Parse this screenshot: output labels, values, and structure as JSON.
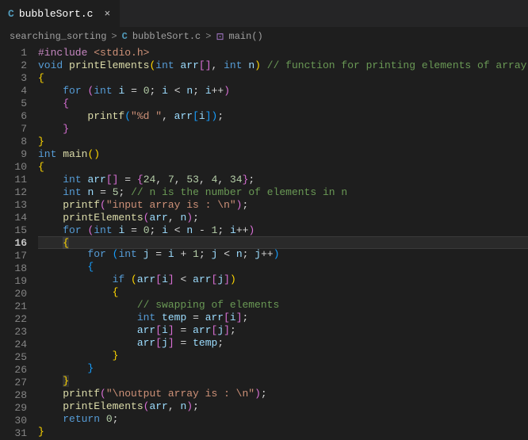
{
  "tab": {
    "icon": "C",
    "label": "bubbleSort.c",
    "close": "×"
  },
  "breadcrumbs": {
    "folder": "searching_sorting",
    "sep": ">",
    "file_icon": "C",
    "file": "bubbleSort.c",
    "fn_icon": "⊡",
    "fn": "main()"
  },
  "active_line": 16,
  "lines": [
    {
      "n": 1,
      "tokens": [
        [
          "tok-pp",
          "#include"
        ],
        [
          "tok-pn",
          " "
        ],
        [
          "tok-str",
          "<stdio.h>"
        ]
      ]
    },
    {
      "n": 2,
      "tokens": [
        [
          "tok-type",
          "void"
        ],
        [
          "tok-pn",
          " "
        ],
        [
          "tok-fn",
          "printElements"
        ],
        [
          "tok-br0",
          "("
        ],
        [
          "tok-type",
          "int"
        ],
        [
          "tok-pn",
          " "
        ],
        [
          "tok-var",
          "arr"
        ],
        [
          "tok-br1",
          "["
        ],
        [
          "tok-br1",
          "]"
        ],
        [
          "tok-pn",
          ", "
        ],
        [
          "tok-type",
          "int"
        ],
        [
          "tok-pn",
          " "
        ],
        [
          "tok-var",
          "n"
        ],
        [
          "tok-br0",
          ")"
        ],
        [
          "tok-pn",
          " "
        ],
        [
          "tok-cmt",
          "// function for printing elements of array"
        ]
      ]
    },
    {
      "n": 3,
      "tokens": [
        [
          "tok-br0",
          "{"
        ]
      ]
    },
    {
      "n": 4,
      "tokens": [
        [
          "tok-pn",
          "    "
        ],
        [
          "tok-kw",
          "for"
        ],
        [
          "tok-pn",
          " "
        ],
        [
          "tok-br1",
          "("
        ],
        [
          "tok-type",
          "int"
        ],
        [
          "tok-pn",
          " "
        ],
        [
          "tok-var",
          "i"
        ],
        [
          "tok-pn",
          " "
        ],
        [
          "tok-op",
          "="
        ],
        [
          "tok-pn",
          " "
        ],
        [
          "tok-num",
          "0"
        ],
        [
          "tok-pn",
          "; "
        ],
        [
          "tok-var",
          "i"
        ],
        [
          "tok-pn",
          " "
        ],
        [
          "tok-op",
          "<"
        ],
        [
          "tok-pn",
          " "
        ],
        [
          "tok-var",
          "n"
        ],
        [
          "tok-pn",
          "; "
        ],
        [
          "tok-var",
          "i"
        ],
        [
          "tok-op",
          "++"
        ],
        [
          "tok-br1",
          ")"
        ]
      ]
    },
    {
      "n": 5,
      "tokens": [
        [
          "tok-pn",
          "    "
        ],
        [
          "tok-br1",
          "{"
        ]
      ]
    },
    {
      "n": 6,
      "tokens": [
        [
          "tok-pn",
          "        "
        ],
        [
          "tok-fn",
          "printf"
        ],
        [
          "tok-br2",
          "("
        ],
        [
          "tok-str",
          "\"%d \""
        ],
        [
          "tok-pn",
          ", "
        ],
        [
          "tok-var",
          "arr"
        ],
        [
          "tok-br2",
          "["
        ],
        [
          "tok-var",
          "i"
        ],
        [
          "tok-br2",
          "]"
        ],
        [
          "tok-br2",
          ")"
        ],
        [
          "tok-pn",
          ";"
        ]
      ]
    },
    {
      "n": 7,
      "tokens": [
        [
          "tok-pn",
          "    "
        ],
        [
          "tok-br1",
          "}"
        ]
      ]
    },
    {
      "n": 8,
      "tokens": [
        [
          "tok-br0",
          "}"
        ]
      ]
    },
    {
      "n": 9,
      "tokens": [
        [
          "tok-type",
          "int"
        ],
        [
          "tok-pn",
          " "
        ],
        [
          "tok-fn",
          "main"
        ],
        [
          "tok-br0",
          "("
        ],
        [
          "tok-br0",
          ")"
        ]
      ]
    },
    {
      "n": 10,
      "tokens": [
        [
          "tok-br0",
          "{"
        ]
      ]
    },
    {
      "n": 11,
      "tokens": [
        [
          "tok-pn",
          "    "
        ],
        [
          "tok-type",
          "int"
        ],
        [
          "tok-pn",
          " "
        ],
        [
          "tok-var",
          "arr"
        ],
        [
          "tok-br1",
          "["
        ],
        [
          "tok-br1",
          "]"
        ],
        [
          "tok-pn",
          " "
        ],
        [
          "tok-op",
          "="
        ],
        [
          "tok-pn",
          " "
        ],
        [
          "tok-br1",
          "{"
        ],
        [
          "tok-num",
          "24"
        ],
        [
          "tok-pn",
          ", "
        ],
        [
          "tok-num",
          "7"
        ],
        [
          "tok-pn",
          ", "
        ],
        [
          "tok-num",
          "53"
        ],
        [
          "tok-pn",
          ", "
        ],
        [
          "tok-num",
          "4"
        ],
        [
          "tok-pn",
          ", "
        ],
        [
          "tok-num",
          "34"
        ],
        [
          "tok-br1",
          "}"
        ],
        [
          "tok-pn",
          ";"
        ]
      ]
    },
    {
      "n": 12,
      "tokens": [
        [
          "tok-pn",
          "    "
        ],
        [
          "tok-type",
          "int"
        ],
        [
          "tok-pn",
          " "
        ],
        [
          "tok-var",
          "n"
        ],
        [
          "tok-pn",
          " "
        ],
        [
          "tok-op",
          "="
        ],
        [
          "tok-pn",
          " "
        ],
        [
          "tok-num",
          "5"
        ],
        [
          "tok-pn",
          "; "
        ],
        [
          "tok-cmt",
          "// n is the number of elements in n"
        ]
      ]
    },
    {
      "n": 13,
      "tokens": [
        [
          "tok-pn",
          "    "
        ],
        [
          "tok-fn",
          "printf"
        ],
        [
          "tok-br1",
          "("
        ],
        [
          "tok-str",
          "\"input array is : \\n\""
        ],
        [
          "tok-br1",
          ")"
        ],
        [
          "tok-pn",
          ";"
        ]
      ]
    },
    {
      "n": 14,
      "tokens": [
        [
          "tok-pn",
          "    "
        ],
        [
          "tok-fn",
          "printElements"
        ],
        [
          "tok-br1",
          "("
        ],
        [
          "tok-var",
          "arr"
        ],
        [
          "tok-pn",
          ", "
        ],
        [
          "tok-var",
          "n"
        ],
        [
          "tok-br1",
          ")"
        ],
        [
          "tok-pn",
          ";"
        ]
      ]
    },
    {
      "n": 15,
      "tokens": [
        [
          "tok-pn",
          "    "
        ],
        [
          "tok-kw",
          "for"
        ],
        [
          "tok-pn",
          " "
        ],
        [
          "tok-br1",
          "("
        ],
        [
          "tok-type",
          "int"
        ],
        [
          "tok-pn",
          " "
        ],
        [
          "tok-var",
          "i"
        ],
        [
          "tok-pn",
          " "
        ],
        [
          "tok-op",
          "="
        ],
        [
          "tok-pn",
          " "
        ],
        [
          "tok-num",
          "0"
        ],
        [
          "tok-pn",
          "; "
        ],
        [
          "tok-var",
          "i"
        ],
        [
          "tok-pn",
          " "
        ],
        [
          "tok-op",
          "<"
        ],
        [
          "tok-pn",
          " "
        ],
        [
          "tok-var",
          "n"
        ],
        [
          "tok-pn",
          " "
        ],
        [
          "tok-op",
          "-"
        ],
        [
          "tok-pn",
          " "
        ],
        [
          "tok-num",
          "1"
        ],
        [
          "tok-pn",
          "; "
        ],
        [
          "tok-var",
          "i"
        ],
        [
          "tok-op",
          "++"
        ],
        [
          "tok-br1",
          ")"
        ]
      ]
    },
    {
      "n": 16,
      "tokens": [
        [
          "tok-pn",
          "    "
        ],
        [
          "tok-bb",
          "{"
        ]
      ]
    },
    {
      "n": 17,
      "tokens": [
        [
          "tok-pn",
          "        "
        ],
        [
          "tok-kw",
          "for"
        ],
        [
          "tok-pn",
          " "
        ],
        [
          "tok-br2",
          "("
        ],
        [
          "tok-type",
          "int"
        ],
        [
          "tok-pn",
          " "
        ],
        [
          "tok-var",
          "j"
        ],
        [
          "tok-pn",
          " "
        ],
        [
          "tok-op",
          "="
        ],
        [
          "tok-pn",
          " "
        ],
        [
          "tok-var",
          "i"
        ],
        [
          "tok-pn",
          " "
        ],
        [
          "tok-op",
          "+"
        ],
        [
          "tok-pn",
          " "
        ],
        [
          "tok-num",
          "1"
        ],
        [
          "tok-pn",
          "; "
        ],
        [
          "tok-var",
          "j"
        ],
        [
          "tok-pn",
          " "
        ],
        [
          "tok-op",
          "<"
        ],
        [
          "tok-pn",
          " "
        ],
        [
          "tok-var",
          "n"
        ],
        [
          "tok-pn",
          "; "
        ],
        [
          "tok-var",
          "j"
        ],
        [
          "tok-op",
          "++"
        ],
        [
          "tok-br2",
          ")"
        ]
      ]
    },
    {
      "n": 18,
      "tokens": [
        [
          "tok-pn",
          "        "
        ],
        [
          "tok-br2",
          "{"
        ]
      ]
    },
    {
      "n": 19,
      "tokens": [
        [
          "tok-pn",
          "            "
        ],
        [
          "tok-kw",
          "if"
        ],
        [
          "tok-pn",
          " "
        ],
        [
          "tok-br0",
          "("
        ],
        [
          "tok-var",
          "arr"
        ],
        [
          "tok-br1",
          "["
        ],
        [
          "tok-var",
          "i"
        ],
        [
          "tok-br1",
          "]"
        ],
        [
          "tok-pn",
          " "
        ],
        [
          "tok-op",
          "<"
        ],
        [
          "tok-pn",
          " "
        ],
        [
          "tok-var",
          "arr"
        ],
        [
          "tok-br1",
          "["
        ],
        [
          "tok-var",
          "j"
        ],
        [
          "tok-br1",
          "]"
        ],
        [
          "tok-br0",
          ")"
        ]
      ]
    },
    {
      "n": 20,
      "tokens": [
        [
          "tok-pn",
          "            "
        ],
        [
          "tok-br0",
          "{"
        ]
      ]
    },
    {
      "n": 21,
      "tokens": [
        [
          "tok-pn",
          "                "
        ],
        [
          "tok-cmt",
          "// swapping of elements"
        ]
      ]
    },
    {
      "n": 22,
      "tokens": [
        [
          "tok-pn",
          "                "
        ],
        [
          "tok-type",
          "int"
        ],
        [
          "tok-pn",
          " "
        ],
        [
          "tok-var",
          "temp"
        ],
        [
          "tok-pn",
          " "
        ],
        [
          "tok-op",
          "="
        ],
        [
          "tok-pn",
          " "
        ],
        [
          "tok-var",
          "arr"
        ],
        [
          "tok-br1",
          "["
        ],
        [
          "tok-var",
          "i"
        ],
        [
          "tok-br1",
          "]"
        ],
        [
          "tok-pn",
          ";"
        ]
      ]
    },
    {
      "n": 23,
      "tokens": [
        [
          "tok-pn",
          "                "
        ],
        [
          "tok-var",
          "arr"
        ],
        [
          "tok-br1",
          "["
        ],
        [
          "tok-var",
          "i"
        ],
        [
          "tok-br1",
          "]"
        ],
        [
          "tok-pn",
          " "
        ],
        [
          "tok-op",
          "="
        ],
        [
          "tok-pn",
          " "
        ],
        [
          "tok-var",
          "arr"
        ],
        [
          "tok-br1",
          "["
        ],
        [
          "tok-var",
          "j"
        ],
        [
          "tok-br1",
          "]"
        ],
        [
          "tok-pn",
          ";"
        ]
      ]
    },
    {
      "n": 24,
      "tokens": [
        [
          "tok-pn",
          "                "
        ],
        [
          "tok-var",
          "arr"
        ],
        [
          "tok-br1",
          "["
        ],
        [
          "tok-var",
          "j"
        ],
        [
          "tok-br1",
          "]"
        ],
        [
          "tok-pn",
          " "
        ],
        [
          "tok-op",
          "="
        ],
        [
          "tok-pn",
          " "
        ],
        [
          "tok-var",
          "temp"
        ],
        [
          "tok-pn",
          ";"
        ]
      ]
    },
    {
      "n": 25,
      "tokens": [
        [
          "tok-pn",
          "            "
        ],
        [
          "tok-br0",
          "}"
        ]
      ]
    },
    {
      "n": 26,
      "tokens": [
        [
          "tok-pn",
          "        "
        ],
        [
          "tok-br2",
          "}"
        ]
      ]
    },
    {
      "n": 27,
      "tokens": [
        [
          "tok-pn",
          "    "
        ],
        [
          "tok-bb",
          "}"
        ]
      ]
    },
    {
      "n": 28,
      "tokens": [
        [
          "tok-pn",
          "    "
        ],
        [
          "tok-fn",
          "printf"
        ],
        [
          "tok-br1",
          "("
        ],
        [
          "tok-str",
          "\"\\noutput array is : \\n\""
        ],
        [
          "tok-br1",
          ")"
        ],
        [
          "tok-pn",
          ";"
        ]
      ]
    },
    {
      "n": 29,
      "tokens": [
        [
          "tok-pn",
          "    "
        ],
        [
          "tok-fn",
          "printElements"
        ],
        [
          "tok-br1",
          "("
        ],
        [
          "tok-var",
          "arr"
        ],
        [
          "tok-pn",
          ", "
        ],
        [
          "tok-var",
          "n"
        ],
        [
          "tok-br1",
          ")"
        ],
        [
          "tok-pn",
          ";"
        ]
      ]
    },
    {
      "n": 30,
      "tokens": [
        [
          "tok-pn",
          "    "
        ],
        [
          "tok-kw",
          "return"
        ],
        [
          "tok-pn",
          " "
        ],
        [
          "tok-num",
          "0"
        ],
        [
          "tok-pn",
          ";"
        ]
      ]
    },
    {
      "n": 31,
      "tokens": [
        [
          "tok-br0",
          "}"
        ]
      ]
    }
  ]
}
